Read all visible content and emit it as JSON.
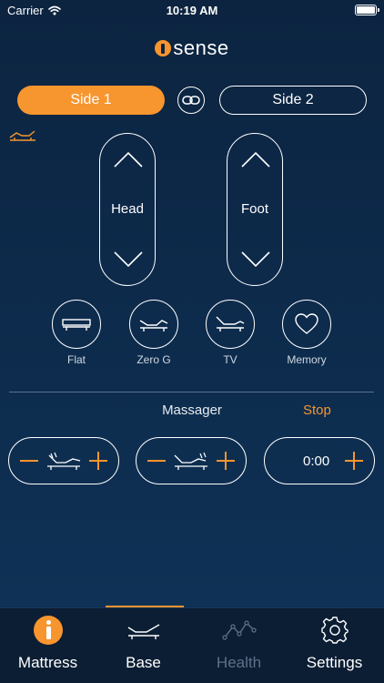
{
  "status_bar": {
    "carrier": "Carrier",
    "time": "10:19 AM"
  },
  "logo": {
    "text": "sense"
  },
  "sides": {
    "side1": "Side 1",
    "side2": "Side 2"
  },
  "controls": {
    "head": "Head",
    "foot": "Foot"
  },
  "presets": [
    {
      "label": "Flat",
      "icon": "flat-bed-icon"
    },
    {
      "label": "Zero G",
      "icon": "zero-g-bed-icon"
    },
    {
      "label": "TV",
      "icon": "tv-bed-icon"
    },
    {
      "label": "Memory",
      "icon": "heart-icon"
    }
  ],
  "massager": {
    "title": "Massager",
    "stop": "Stop",
    "timer": "0:00"
  },
  "tabs": [
    {
      "label": "Mattress",
      "active": false
    },
    {
      "label": "Base",
      "active": true
    },
    {
      "label": "Health",
      "active": false,
      "disabled": true
    },
    {
      "label": "Settings",
      "active": false
    }
  ],
  "colors": {
    "accent": "#f7952f",
    "background": "#0c2440",
    "tabbar": "#0c1e34",
    "disabled": "#5f7189"
  }
}
